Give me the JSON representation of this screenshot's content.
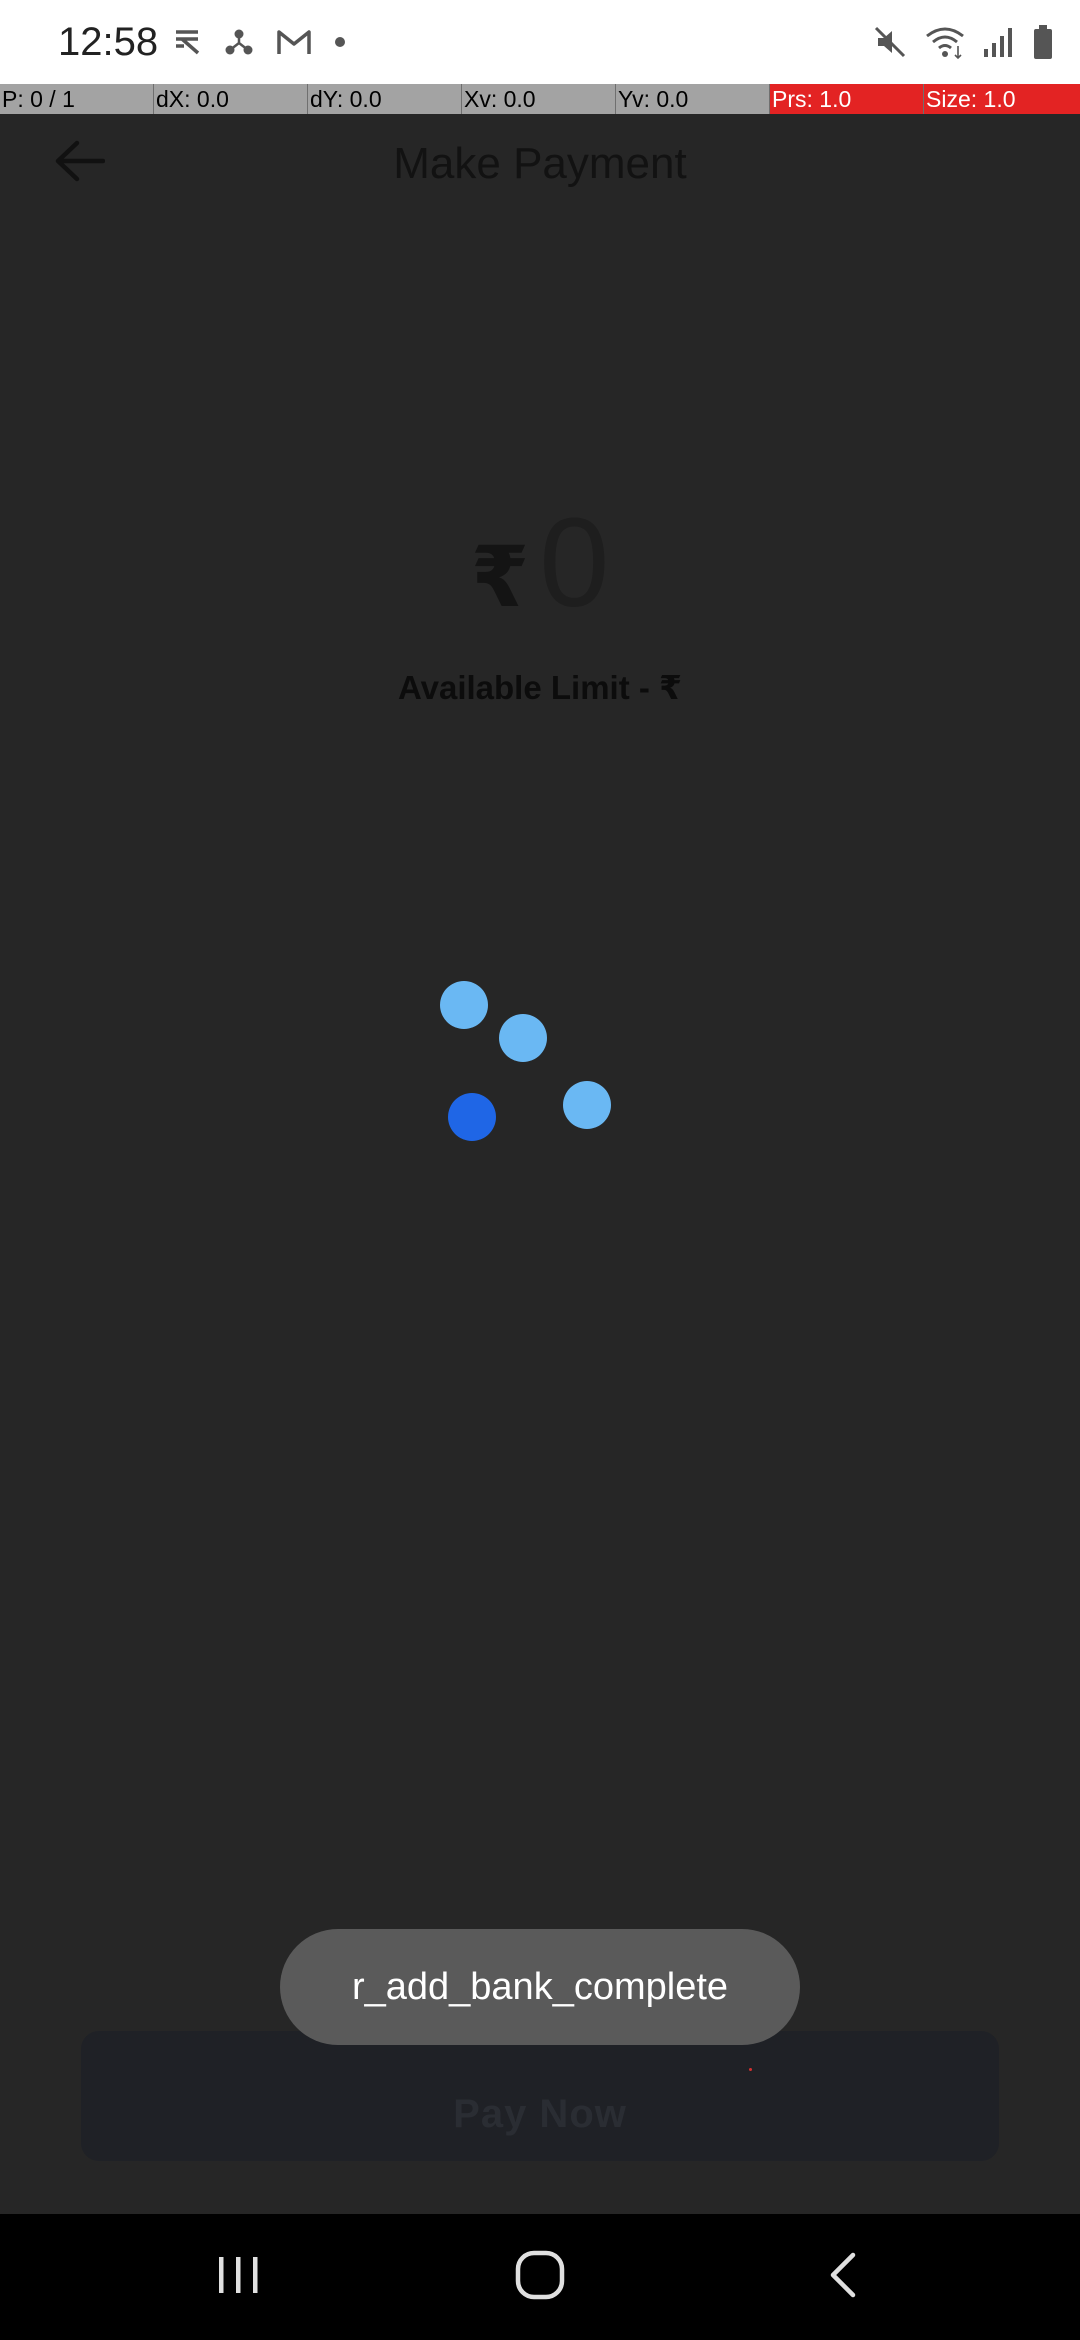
{
  "status_bar": {
    "time": "12:58",
    "left_icons": [
      "rupee-app-icon",
      "share-icon",
      "gmail-icon",
      "dot-icon"
    ],
    "right_icons": [
      "mute-icon",
      "wifi-icon",
      "signal-icon",
      "battery-icon"
    ]
  },
  "pointer_overlay": {
    "p": "P: 0 / 1",
    "dx": "dX: 0.0",
    "dy": "dY: 0.0",
    "xv": "Xv: 0.0",
    "yv": "Yv: 0.0",
    "prs": "Prs: 1.0",
    "size": "Size: 1.0",
    "alert_color": "#e32323"
  },
  "header": {
    "title": "Make Payment",
    "back_icon": "arrow-left-icon"
  },
  "amount": {
    "currency": "₹",
    "value": "0"
  },
  "available_limit": "Available Limit - ₹",
  "loader": {
    "dot_colors": [
      "#6ab8f3",
      "#6ab8f3",
      "#6ab8f3",
      "#1f66e6"
    ]
  },
  "toast": {
    "message": "r_add_bank_complete"
  },
  "pay_button": {
    "label": "Pay Now"
  },
  "nav_bar": {
    "icons": [
      "recents-icon",
      "home-icon",
      "back-icon"
    ]
  }
}
